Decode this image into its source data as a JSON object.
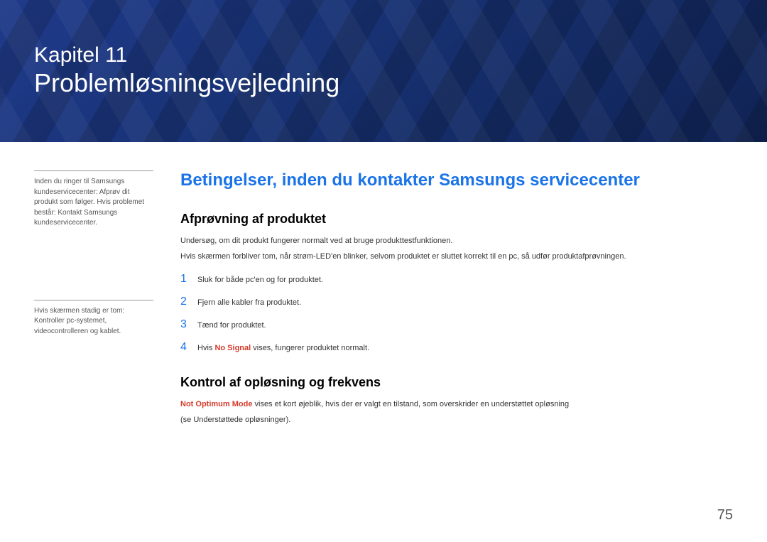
{
  "banner": {
    "chapter_label": "Kapitel 11",
    "chapter_title": "Problemløsningsvejledning"
  },
  "sidebar": {
    "note1": "Inden du ringer til Samsungs kundeservicecenter: Afprøv dit produkt som følger. Hvis problemet består: Kontakt Samsungs kundeservicecenter.",
    "note2": "Hvis skærmen stadig er tom: Kontroller pc-systemet, videocontrolleren og kablet."
  },
  "main": {
    "section_title": "Betingelser, inden du kontakter Samsungs servicecenter",
    "sub1_title": "Afprøvning af produktet",
    "sub1_p1": "Undersøg, om dit produkt fungerer normalt ved at bruge produkttestfunktionen.",
    "sub1_p2": "Hvis skærmen forbliver tom, når strøm-LED'en blinker, selvom produktet er sluttet korrekt til en pc, så udfør produktafprøvningen.",
    "steps": [
      {
        "num": "1",
        "text": "Sluk for både pc'en og for produktet."
      },
      {
        "num": "2",
        "text": "Fjern alle kabler fra produktet."
      },
      {
        "num": "3",
        "text": "Tænd for produktet."
      },
      {
        "num": "4",
        "prefix": "Hvis ",
        "bold": "No Signal",
        "suffix": " vises, fungerer produktet normalt."
      }
    ],
    "sub2_title": "Kontrol af opløsning og frekvens",
    "sub2_bold": "Not Optimum Mode",
    "sub2_rest": " vises et kort øjeblik, hvis der er valgt en tilstand, som overskrider en understøttet opløsning",
    "sub2_p2": "(se Understøttede opløsninger)."
  },
  "page_number": "75"
}
